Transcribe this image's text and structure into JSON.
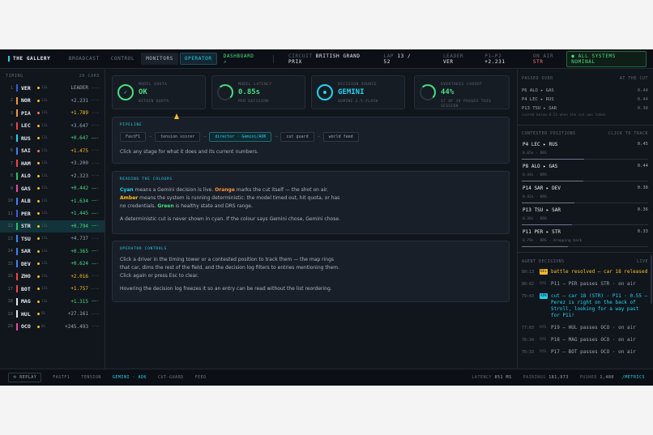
{
  "header": {
    "brand": "THE GALLERY",
    "tabs": [
      {
        "label": "BROADCAST",
        "state": "idle"
      },
      {
        "label": "CONTROL",
        "state": "idle"
      },
      {
        "label": "MONITORS",
        "state": "hover"
      },
      {
        "label": "OPERATOR",
        "state": "active"
      },
      {
        "label": "DASHBOARD ↗",
        "state": "dash"
      }
    ],
    "circuit_label": "CIRCUIT",
    "circuit": "BRITISH GRAND PRIX",
    "lap_label": "LAP",
    "lap": "13 / 52",
    "leader_label": "LEADER",
    "leader": "VER",
    "p1p2_label": "P1–P2",
    "p1p2": "+2.231",
    "onair_label": "ON AIR",
    "onair": "STR",
    "status": "● ALL SYSTEMS NOMINAL"
  },
  "timing": {
    "title": "TIMING",
    "count": "20 CARS",
    "rows": [
      {
        "pos": "1",
        "code": "VER",
        "team": "#3b5bdb",
        "tyre": "#fbbf24",
        "laps": "13L",
        "gap": "LEADER",
        "gc": "w",
        "trend": "—·—"
      },
      {
        "pos": "2",
        "code": "NOR",
        "team": "#fb923c",
        "tyre": "#fbbf24",
        "laps": "13L",
        "gap": "+2.231",
        "gc": "w",
        "trend": "—·—"
      },
      {
        "pos": "3",
        "code": "PIA",
        "team": "#fb923c",
        "tyre": "#f87171",
        "laps": "13L",
        "gap": "+1.789",
        "gc": "a",
        "trend": "—·—"
      },
      {
        "pos": "4",
        "code": "LEC",
        "team": "#ef4444",
        "tyre": "#fbbf24",
        "laps": "13L",
        "gap": "+3.647",
        "gc": "w",
        "trend": "—·—"
      },
      {
        "pos": "5",
        "code": "RUS",
        "team": "#22d3ee",
        "tyre": "#fbbf24",
        "laps": "13L",
        "gap": "+0.647",
        "gc": "g",
        "trend": "——·"
      },
      {
        "pos": "6",
        "code": "SAI",
        "team": "#3b82f6",
        "tyre": "#f87171",
        "laps": "13L",
        "gap": "+1.475",
        "gc": "a",
        "trend": "—·—"
      },
      {
        "pos": "7",
        "code": "HAM",
        "team": "#ef4444",
        "tyre": "#fbbf24",
        "laps": "13L",
        "gap": "+3.200",
        "gc": "w",
        "trend": "—·—"
      },
      {
        "pos": "8",
        "code": "ALO",
        "team": "#22c55e",
        "tyre": "#fbbf24",
        "laps": "13L",
        "gap": "+2.323",
        "gc": "w",
        "trend": "—·—"
      },
      {
        "pos": "9",
        "code": "GAS",
        "team": "#ec4899",
        "tyre": "#fbbf24",
        "laps": "13L",
        "gap": "+0.442",
        "gc": "g",
        "trend": "——·"
      },
      {
        "pos": "10",
        "code": "ALB",
        "team": "#3b82f6",
        "tyre": "#fbbf24",
        "laps": "13L",
        "gap": "+1.634",
        "gc": "g",
        "trend": "——·"
      },
      {
        "pos": "11",
        "code": "PER",
        "team": "#3b5bdb",
        "tyre": "#fbbf24",
        "laps": "13L",
        "gap": "+1.445",
        "gc": "g",
        "trend": "——·"
      },
      {
        "pos": "12",
        "code": "STR",
        "team": "#22c55e",
        "tyre": "#fbbf24",
        "laps": "13L",
        "gap": "+0.794",
        "gc": "g",
        "trend": "——·"
      },
      {
        "pos": "13",
        "code": "TSU",
        "team": "#3b82f6",
        "tyre": "#fbbf24",
        "laps": "13L",
        "gap": "+4.737",
        "gc": "w",
        "trend": "—·—"
      },
      {
        "pos": "14",
        "code": "SAR",
        "team": "#3b82f6",
        "tyre": "#fbbf24",
        "laps": "13L",
        "gap": "+0.365",
        "gc": "g",
        "trend": "——·"
      },
      {
        "pos": "15",
        "code": "DEV",
        "team": "#3b82f6",
        "tyre": "#fbbf24",
        "laps": "13L",
        "gap": "+0.624",
        "gc": "g",
        "trend": "——·"
      },
      {
        "pos": "16",
        "code": "ZHO",
        "team": "#ef4444",
        "tyre": "#fbbf24",
        "laps": "13L",
        "gap": "+2.016",
        "gc": "a",
        "trend": "—·—"
      },
      {
        "pos": "17",
        "code": "BOT",
        "team": "#ef4444",
        "tyre": "#fbbf24",
        "laps": "13L",
        "gap": "+1.757",
        "gc": "a",
        "trend": "—·—"
      },
      {
        "pos": "18",
        "code": "MAG",
        "team": "#e5e7eb",
        "tyre": "#fbbf24",
        "laps": "13L",
        "gap": "+1.315",
        "gc": "g",
        "trend": "——·"
      },
      {
        "pos": "19",
        "code": "HUL",
        "team": "#e5e7eb",
        "tyre": "#fbbf24",
        "laps": "8L",
        "gap": "+27.161",
        "gc": "w",
        "trend": "—·—"
      },
      {
        "pos": "20",
        "code": "OCO",
        "team": "#ec4899",
        "tyre": "#fbbf24",
        "laps": "8L",
        "gap": "+245.493",
        "gc": "w",
        "trend": "—·—"
      }
    ]
  },
  "kpis": [
    {
      "label": "MODEL QUOTA",
      "value": "OK",
      "sub": "WITHIN QUOTA",
      "color": "#4ade80",
      "ring": "ok"
    },
    {
      "label": "MODEL LATENCY",
      "value": "0.85s",
      "sub": "PER DECISION",
      "color": "#4ade80",
      "ring": "partial"
    },
    {
      "label": "DECISION SOURCE",
      "value": "GEMINI",
      "sub": "GEMINI-2.5-FLASH",
      "color": "#22d3ee",
      "ring": "dot"
    },
    {
      "label": "OVERTAKES CAUGHT",
      "value": "44%",
      "sub": "17 OF 39 PASSES THIS SESSION",
      "color": "#4ade80",
      "ring": "partial"
    }
  ],
  "pipeline": {
    "title": "PIPELINE",
    "stages": [
      "FastF1",
      "tension scorer",
      "director · Gemini/ADK",
      "cut guard",
      "world feed"
    ],
    "hint": "Click any stage for what it does and its current numbers."
  },
  "colours": {
    "title": "READING THE COLOURS",
    "w1": "Cyan",
    "t1": " means a Gemini decision is live. ",
    "w2": "Orange",
    "t2": " marks the cut itself — the shot on air. ",
    "w3": "Amber",
    "t3": " means the system is running deterministic: the model timed out, hit quota, or has no credentials. ",
    "w4": "Green",
    "t4": " is healthy state and DRS range.",
    "p2": "A deterministic cut is never shown in cyan. If the colour says Gemini chose, Gemini chose."
  },
  "operator": {
    "title": "OPERATOR CONTROLS",
    "p1": "Click a driver in the timing tower or a contested position to track them — the map rings that car, dims the rest of the field, and the decision log filters to entries mentioning them. Click again or press Esc to clear.",
    "p2": "Hovering the decision log freezes it so an entry can be read without the list reordering."
  },
  "passed_over": {
    "title": "PASSED OVER",
    "note": "AT THE CUT",
    "rows": [
      {
        "t": "P6  ALO ▸ GAS",
        "v": "0.44"
      },
      {
        "t": "P4  LEC ▸ RUS",
        "v": "0.44"
      },
      {
        "t": "P13 TSU ▸ SAR",
        "v": "0.38"
      }
    ],
    "scored": "scored below 0.53 when the cut was taken"
  },
  "contested": {
    "title": "CONTESTED POSITIONS",
    "hint": "CLICK TO TRACK",
    "rows": [
      {
        "t": "P4  LEC ▸ RUS",
        "v": "0.45",
        "s": "0.65s · DRS",
        "frac": 0.45
      },
      {
        "t": "P8  ALO ▸ GAS",
        "v": "0.44",
        "s": "0.44s · DRS",
        "frac": 0.44
      },
      {
        "t": "P14 SAR ▸ DEV",
        "v": "0.38",
        "s": "0.42s · DRS",
        "frac": 0.38
      },
      {
        "t": "P13 TSU ▸ SAR",
        "v": "0.36",
        "s": "0.36s · DRS",
        "frac": 0.36
      },
      {
        "t": "P11 PER ▸ STR",
        "v": "0.33",
        "s": "0.79s · DRS · dropping back",
        "frac": 0.33
      }
    ]
  },
  "decisions": {
    "title": "AGENT DECISIONS",
    "hint": "LIVE",
    "rows": [
      {
        "ts": "80:13",
        "tag": "DEL",
        "tc": "bg",
        "txt": "battle resolved — car 18 released",
        "cls": "am"
      },
      {
        "ts": "80:02",
        "tag": "SYS",
        "tc": "",
        "txt": "P11 — PER passes STR · on air",
        "cls": ""
      },
      {
        "ts": "79:43",
        "tag": "ADK",
        "tc": "cy",
        "txt": "cut — car 18 (STR) · P11 · 0.55 — Perez is right on the back of Stroll, looking for a way past for P11!",
        "cls": "cy"
      },
      {
        "ts": "77:03",
        "tag": "SYS",
        "tc": "",
        "txt": "P19 — HUL passes OCO · on air",
        "cls": ""
      },
      {
        "ts": "76:34",
        "tag": "SYS",
        "tc": "",
        "txt": "P18 — MAG passes OCO · on air",
        "cls": ""
      },
      {
        "ts": "76:33",
        "tag": "SYS",
        "tc": "",
        "txt": "P17 — BOT passes OCO · on air",
        "cls": ""
      }
    ]
  },
  "footer": {
    "replay": "⟲ REPLAY",
    "items": [
      {
        "label": "FASTF1",
        "act": false
      },
      {
        "label": "TENSION",
        "act": false
      },
      {
        "label": "GEMINI · ADK",
        "act": true
      },
      {
        "label": "CUT-GUARD",
        "act": false
      },
      {
        "label": "FEED",
        "act": false
      }
    ],
    "latency_label": "LATENCY",
    "latency": "851 MS",
    "pairings_label": "PAIRINGS",
    "pairings": "181,973",
    "pushed_label": "PUSHED",
    "pushed": "1,480",
    "metrics": "/METRICS"
  }
}
